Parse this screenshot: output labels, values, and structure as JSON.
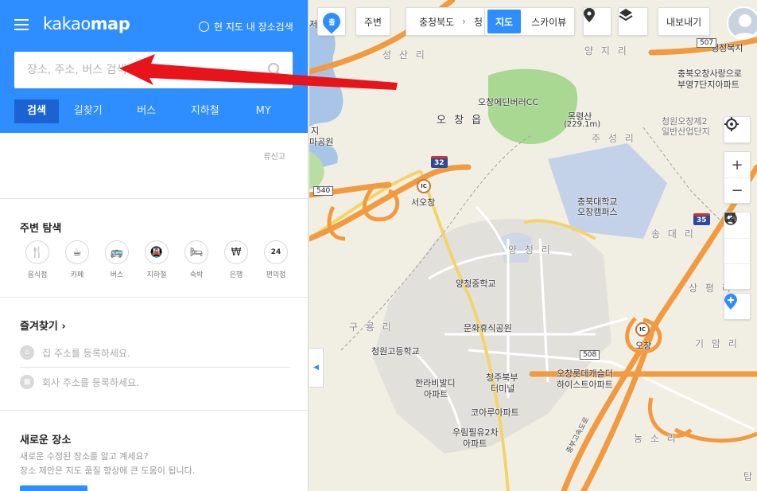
{
  "header": {
    "logo_light": "kakao",
    "logo_bold": "map",
    "local_search_label": "현 지도 내 장소검색"
  },
  "search": {
    "placeholder": "장소, 주소, 버스 검색"
  },
  "tabs": [
    {
      "label": "검색"
    },
    {
      "label": "길찾기"
    },
    {
      "label": "버스"
    },
    {
      "label": "지하철"
    },
    {
      "label": "MY"
    }
  ],
  "notice": "류신고",
  "nearby": {
    "title": "주변 탐색",
    "items": [
      {
        "label": "음식점",
        "icon": "fork-knife-icon",
        "glyph": "🍴"
      },
      {
        "label": "카페",
        "icon": "coffee-cup-icon",
        "glyph": "☕"
      },
      {
        "label": "버스",
        "icon": "bus-icon",
        "glyph": "🚌"
      },
      {
        "label": "지하철",
        "icon": "subway-icon",
        "glyph": "🚇"
      },
      {
        "label": "숙박",
        "icon": "bed-icon",
        "glyph": "🛏"
      },
      {
        "label": "은행",
        "icon": "won-icon",
        "glyph": "₩"
      },
      {
        "label": "편의점",
        "icon": "store-24-icon",
        "glyph": "24"
      }
    ]
  },
  "favorites": {
    "title": "즐겨찾기 ›",
    "home": "집 주소를 등록하세요.",
    "work": "회사 주소를 등록하세요."
  },
  "new_place": {
    "title": "새로운 장소",
    "desc1": "새로운 수정된 장소를 알고 계세요?",
    "desc2": "장소 제안은 지도 품질 향상에 큰 도움이 됩니다."
  },
  "map_toolbar": {
    "start_badge": "출",
    "nearby_btn": "주변",
    "region": "충청북도",
    "region_next": "청",
    "map_btn": "지도",
    "skyview_btn": "스카이뷰",
    "export_btn": "내보내기"
  },
  "map_labels": {
    "seongsan": "성 산 리",
    "yangji": "양 지 리",
    "ochang_eup": "오 창 읍",
    "ochang_cc": "오창에딘버러CC",
    "mokryeong": "목령산",
    "mokryeong_h": "(229.1m)",
    "juseong": "주 성 리",
    "seo_ochang": "서오창",
    "chungbuk_univ1": "충북대학교",
    "chungbuk_univ2": "오창캠퍼스",
    "yangcheong": "양 청 리",
    "songdae": "송 대 리",
    "sangpyeong": "상 평 리",
    "yangcheong_ms": "양청중학교",
    "culture_park": "문화휴식공원",
    "gureong": "구 룡 리",
    "cheongwon_hs": "청원고등학교",
    "hanra1": "한라비발디",
    "hanra2": "아파트",
    "terminal1": "청주북부",
    "terminal2": "터미널",
    "lotte1": "오창롯데캐슬더",
    "lotte2": "하이스트아파트",
    "korea": "코아루아파트",
    "woorim1": "우림필유2차",
    "woorim2": "아파트",
    "giam": "기 암 리",
    "nongso": "농 소 리",
    "ochang_ic": "오창",
    "industrial1": "청원오창제2",
    "industrial2": "일반산업단지",
    "chungbuk_ochang1": "충북오창사랑으로",
    "chungbuk_ochang2": "부영7단지아파트",
    "welfare": "행정복지",
    "park_frag1": "지",
    "park_frag2": "마공원",
    "tab_edge": "탑",
    "top_frag": "저수",
    "hw32": "32",
    "hw35": "35",
    "rd540": "540",
    "rd508": "508",
    "rd507": "507",
    "ic": "IC",
    "expressway": "중부고속도로"
  },
  "colors": {
    "brand_blue": "#2f8eff",
    "tab_active": "#1b62d2",
    "road_orange": "#f29a3f",
    "water": "#a8c4e6",
    "green": "#a5d68b"
  }
}
